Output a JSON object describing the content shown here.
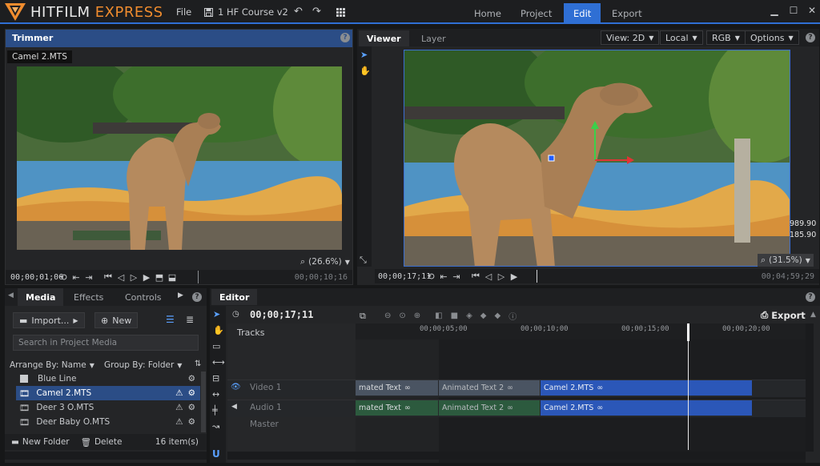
{
  "app": {
    "logo_name": "HITFILM",
    "logo_edition": "EXPRESS",
    "file_menu": "File",
    "project_name": "1 HF Course v2",
    "nav_tabs": [
      "Home",
      "Project",
      "Edit",
      "Export"
    ],
    "active_tab": "Edit",
    "accent_color": "#2f6fd4"
  },
  "trimmer": {
    "title": "Trimmer",
    "clip_name": "Camel 2.MTS",
    "zoom": "(26.6%)",
    "timecode": "00;00;01;06",
    "duration": "00;00;10;16"
  },
  "viewer": {
    "tabs": [
      "Viewer",
      "Layer"
    ],
    "view_mode": "View: 2D",
    "space": "Local",
    "channel": "RGB",
    "options": "Options",
    "zoom": "(31.5%)",
    "coord_x": "989.90",
    "coord_y": "185.90",
    "timecode": "00;00;17;11",
    "duration": "00;04;59;29"
  },
  "media": {
    "tabs": [
      "Media",
      "Effects",
      "Controls"
    ],
    "import_label": "Import...",
    "new_label": "New",
    "search_placeholder": "Search in Project Media",
    "arrange_label": "Arrange By: Name",
    "group_label": "Group By: Folder",
    "items": [
      {
        "name": "Blue Line",
        "type": "plane",
        "warning": false
      },
      {
        "name": "Camel 2.MTS",
        "type": "video",
        "warning": true
      },
      {
        "name": "Deer 3 O.MTS",
        "type": "video",
        "warning": true
      },
      {
        "name": "Deer Baby O.MTS",
        "type": "video",
        "warning": true
      }
    ],
    "new_folder_label": "New Folder",
    "delete_label": "Delete",
    "item_count": "16 item(s)"
  },
  "editor": {
    "title": "Editor",
    "timecode": "00;00;17;11",
    "export_label": "Export",
    "tracks_label": "Tracks",
    "ruler": [
      "00;00;05;00",
      "00;00;10;00",
      "00;00;15;00",
      "00;00;20;00"
    ],
    "tracks": [
      {
        "name": "Video 1",
        "kind": "video"
      },
      {
        "name": "Audio 1",
        "kind": "audio"
      },
      {
        "name": "Master",
        "kind": "master"
      }
    ],
    "video_clips": [
      "mated Text",
      "Animated Text 2",
      "Camel 2.MTS"
    ],
    "audio_clips": [
      "mated Text",
      "Animated Text 2",
      "Camel 2.MTS"
    ]
  }
}
